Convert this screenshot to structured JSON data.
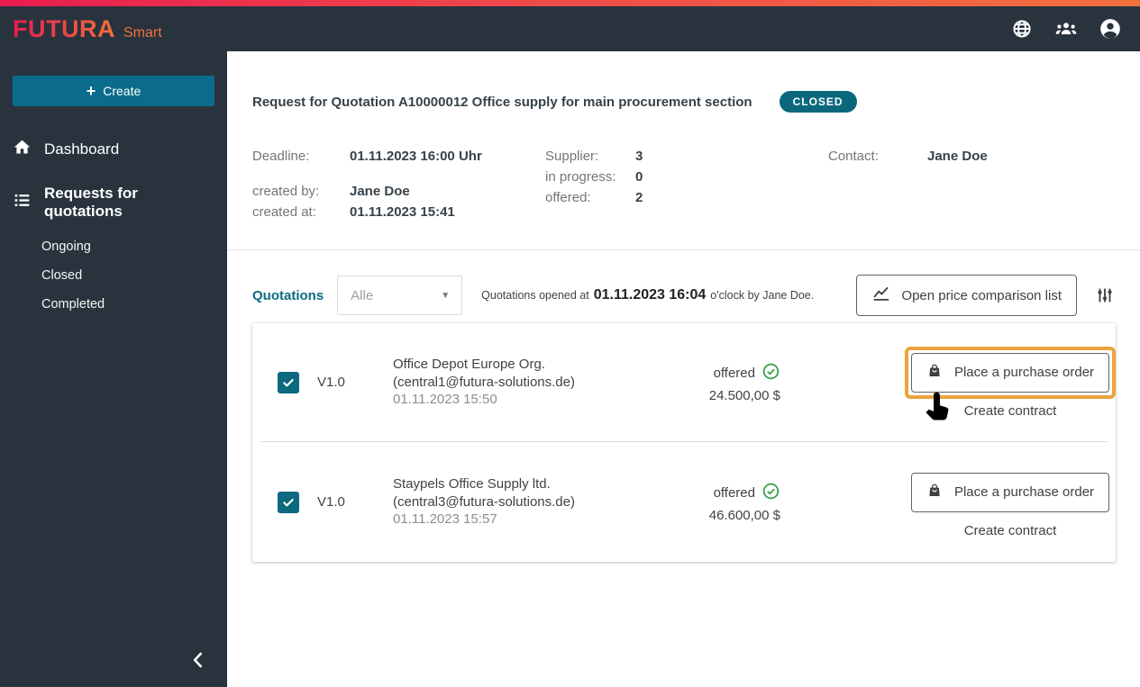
{
  "topbar": {
    "brand": "FUTURA",
    "product": "Smart"
  },
  "sidebar": {
    "create_plus": "+",
    "create_label": "Create",
    "items": [
      {
        "label": "Dashboard"
      },
      {
        "label": "Requests for quotations"
      }
    ],
    "subitems": [
      {
        "label": "Ongoing"
      },
      {
        "label": "Closed"
      },
      {
        "label": "Completed"
      }
    ]
  },
  "header": {
    "title": "Request for Quotation A10000012 Office supply for main procurement section",
    "status_badge": "CLOSED"
  },
  "details": {
    "deadline_label": "Deadline:",
    "deadline_value": "01.11.2023 16:00 Uhr",
    "created_by_label": "created by:",
    "created_by_value": "Jane Doe",
    "created_at_label": "created at:",
    "created_at_value": "01.11.2023 15:41",
    "supplier_label": "Supplier:",
    "supplier_value": "3",
    "in_progress_label": "in progress:",
    "in_progress_value": "0",
    "offered_label": "offered:",
    "offered_value": "2",
    "contact_label": "Contact:",
    "contact_value": "Jane Doe"
  },
  "toolbar": {
    "section_label": "Quotations",
    "filter_selected": "Alle",
    "opened_prefix": "Quotations opened at",
    "opened_time": "01.11.2023 16:04",
    "opened_suffix": "o'clock by Jane Doe.",
    "compare_button_label": "Open price comparison list"
  },
  "quotations": [
    {
      "version": "V1.0",
      "company": "Office Depot Europe Org.",
      "email": "(central1@futura-solutions.de)",
      "submitted": "01.11.2023 15:50",
      "status_label": "offered",
      "amount": "24.500,00 $",
      "order_button_label": "Place a purchase order",
      "contract_link_label": "Create contract"
    },
    {
      "version": "V1.0",
      "company": "Staypels Office Supply ltd.",
      "email": "(central3@futura-solutions.de)",
      "submitted": "01.11.2023 15:57",
      "status_label": "offered",
      "amount": "46.600,00 $",
      "order_button_label": "Place a purchase order",
      "contract_link_label": "Create contract"
    }
  ],
  "colors": {
    "accent_teal": "#0b6b84",
    "navy": "#28333e",
    "highlight_orange": "#eba43b",
    "status_green": "#2f9e41",
    "brand_gradient_start": "#e91d4f",
    "brand_gradient_end": "#f3703d"
  }
}
